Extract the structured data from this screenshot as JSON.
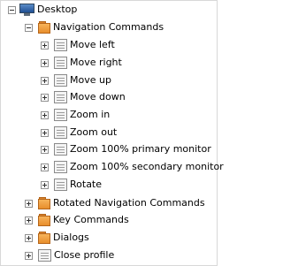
{
  "tree": {
    "root": {
      "label": "Desktop",
      "expanded": true,
      "icon": "monitor-icon"
    },
    "navigation": {
      "label": "Navigation Commands",
      "expanded": true,
      "icon": "folder-icon",
      "children": [
        {
          "label": "Move left"
        },
        {
          "label": "Move right"
        },
        {
          "label": "Move up"
        },
        {
          "label": "Move down"
        },
        {
          "label": "Zoom in"
        },
        {
          "label": "Zoom out"
        },
        {
          "label": "Zoom 100% primary monitor"
        },
        {
          "label": "Zoom 100% secondary monitor"
        },
        {
          "label": "Rotate"
        }
      ]
    },
    "folders": [
      {
        "label": "Rotated Navigation Commands",
        "expanded": false
      },
      {
        "label": "Key Commands",
        "expanded": false
      },
      {
        "label": "Dialogs",
        "expanded": false
      }
    ],
    "close_profile": {
      "label": "Close profile"
    }
  }
}
